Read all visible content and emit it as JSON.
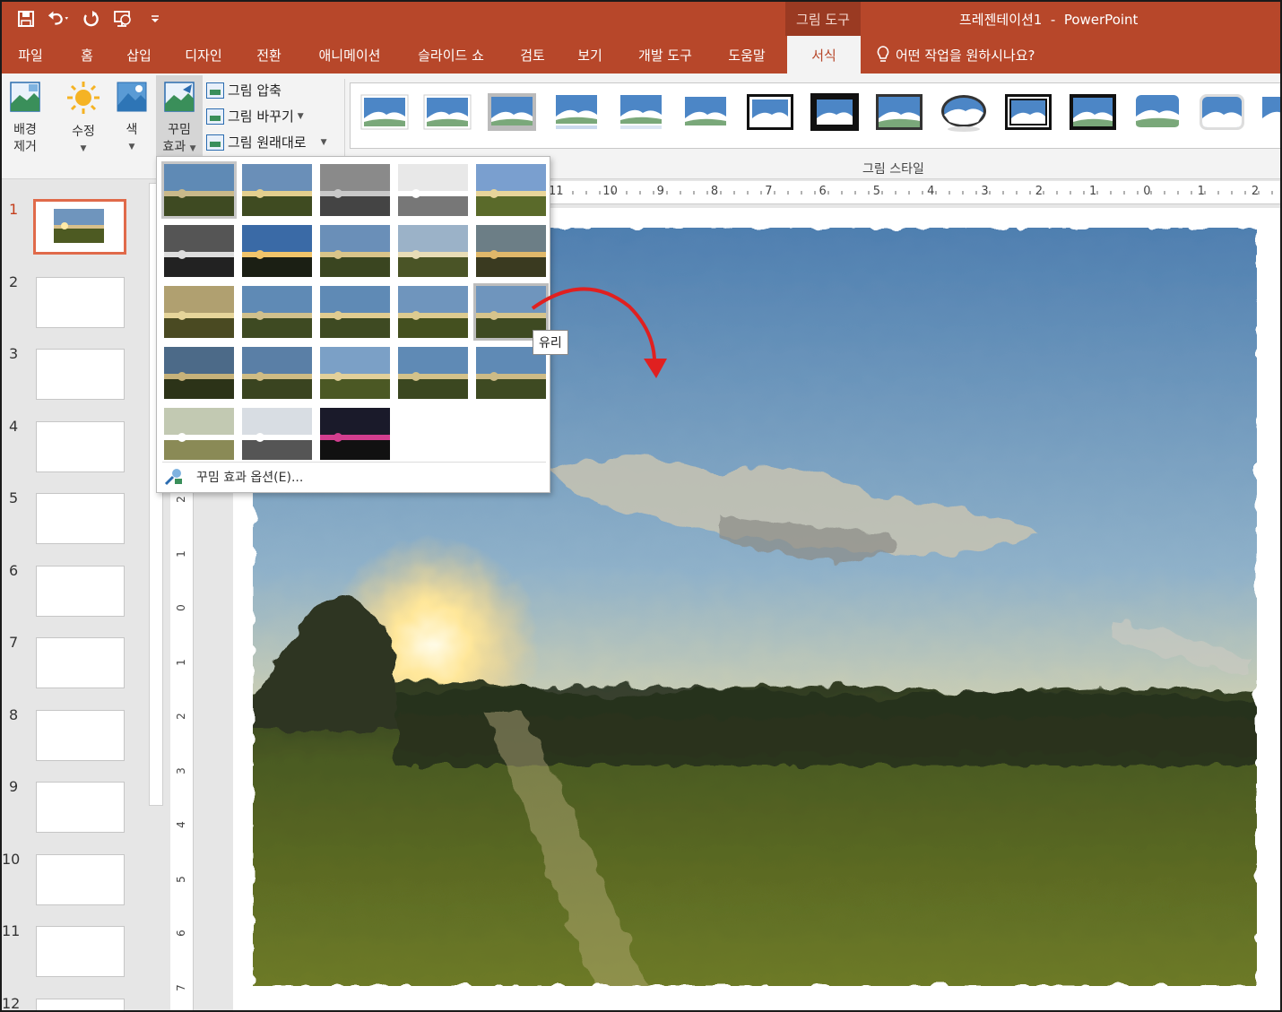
{
  "titlebar": {
    "context_title": "그림 도구",
    "app_title": "프레젠테이션1  -  PowerPoint",
    "qat": [
      {
        "icon": "save-icon"
      },
      {
        "icon": "undo-icon"
      },
      {
        "icon": "redo-icon"
      },
      {
        "icon": "start-from-beginning-icon"
      },
      {
        "icon": "customize-qat-icon"
      }
    ]
  },
  "tabs": [
    {
      "label": "파일"
    },
    {
      "label": "홈"
    },
    {
      "label": "삽입"
    },
    {
      "label": "디자인"
    },
    {
      "label": "전환"
    },
    {
      "label": "애니메이션"
    },
    {
      "label": "슬라이드 쇼"
    },
    {
      "label": "검토"
    },
    {
      "label": "보기"
    },
    {
      "label": "개발 도구"
    },
    {
      "label": "도움말"
    },
    {
      "label": "서식"
    }
  ],
  "tellme": "어떤 작업을 원하시나요?",
  "ribbon": {
    "remove_bg": {
      "line1": "배경",
      "line2": "제거"
    },
    "corrections": "수정",
    "color": "색",
    "artistic": {
      "line1": "꾸밈",
      "line2": "효과"
    },
    "compress": "그림 압축",
    "change": "그림 바꾸기",
    "reset": "그림 원래대로",
    "group_label": "그림 스타일"
  },
  "slides": [
    "1",
    "2",
    "3",
    "4",
    "5",
    "6",
    "7",
    "8",
    "9",
    "10",
    "11",
    "12"
  ],
  "ruler_h": [
    "11",
    "10",
    "9",
    "8",
    "7",
    "6",
    "5",
    "4",
    "3",
    "2",
    "1",
    "0",
    "1",
    "2"
  ],
  "ruler_v": [
    "2",
    "1",
    "0",
    "1",
    "2",
    "3",
    "4",
    "5",
    "6",
    "7"
  ],
  "dropdown": {
    "effects_count": 23,
    "selected_index": 0,
    "hover_index": 14,
    "option": "꾸밈 효과 옵션(E)..."
  },
  "tooltip": "유리",
  "colors": {
    "accent": "#b7472a",
    "arrow": "#e02020"
  }
}
